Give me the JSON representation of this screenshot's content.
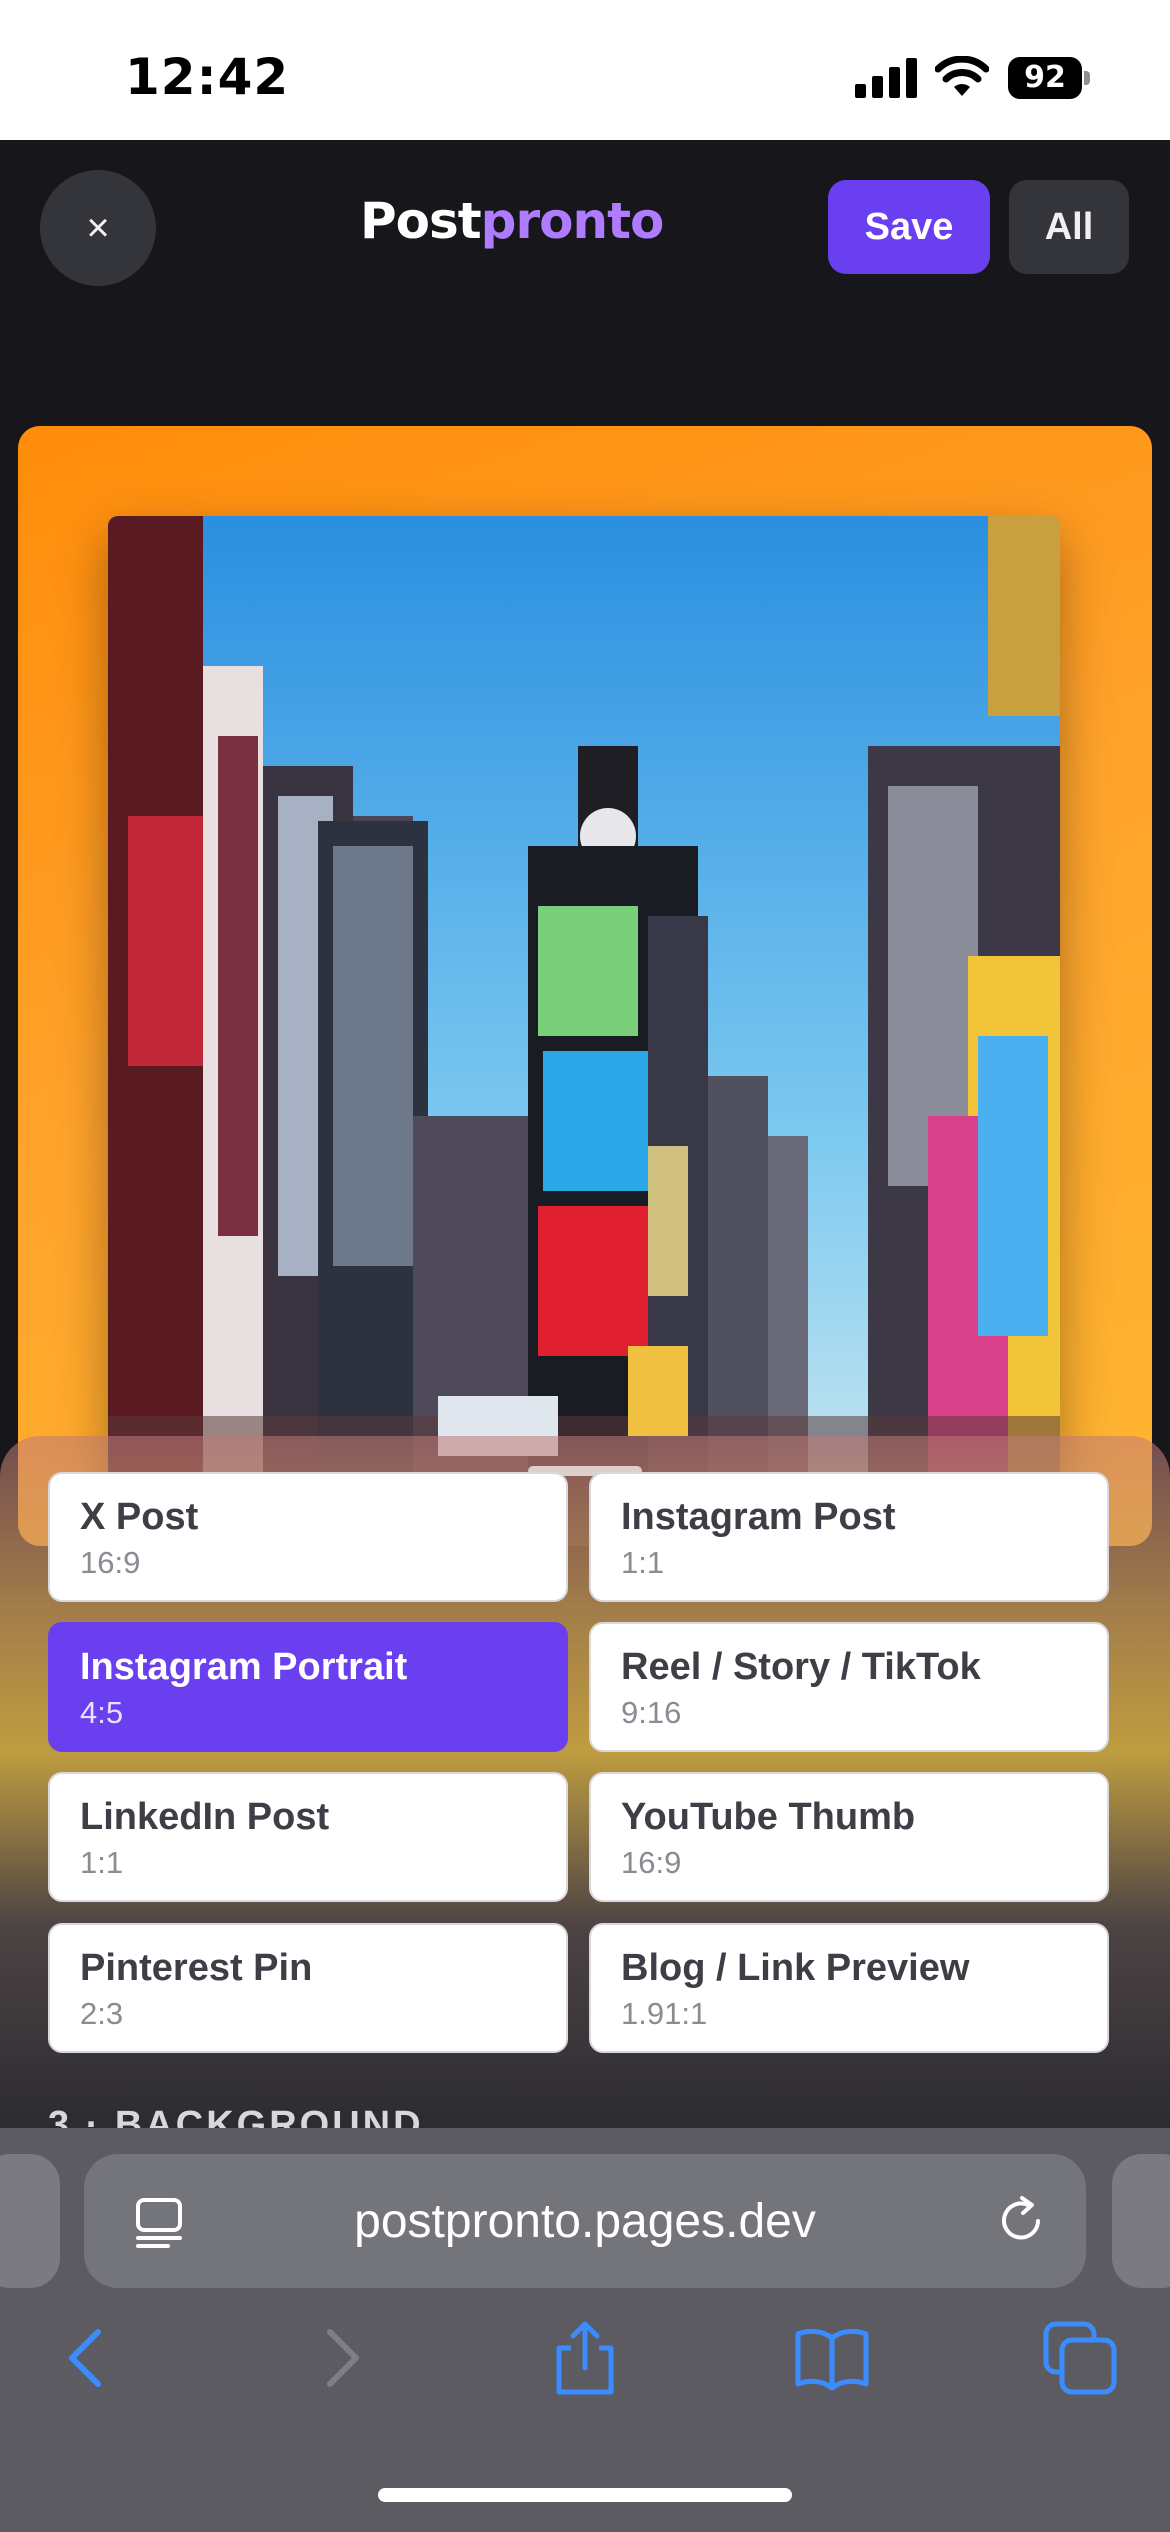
{
  "status_bar": {
    "time": "12:42",
    "battery": "92"
  },
  "header": {
    "close_symbol": "×",
    "logo_part1": "Post",
    "logo_part2": "pronto",
    "save_label": "Save",
    "all_label": "All"
  },
  "presets": [
    {
      "name": "X Post",
      "ratio": "16:9",
      "selected": false
    },
    {
      "name": "Instagram Post",
      "ratio": "1:1",
      "selected": false
    },
    {
      "name": "Instagram Portrait",
      "ratio": "4:5",
      "selected": true
    },
    {
      "name": "Reel / Story / TikTok",
      "ratio": "9:16",
      "selected": false
    },
    {
      "name": "LinkedIn Post",
      "ratio": "1:1",
      "selected": false
    },
    {
      "name": "YouTube Thumb",
      "ratio": "16:9",
      "selected": false
    },
    {
      "name": "Pinterest Pin",
      "ratio": "2:3",
      "selected": false
    },
    {
      "name": "Blog / Link Preview",
      "ratio": "1.91:1",
      "selected": false
    }
  ],
  "section_label": "3 · BACKGROUND",
  "browser": {
    "url": "postpronto.pages.dev"
  },
  "colors": {
    "accent": "#6a3ff0",
    "logo_accent": "#b07cff",
    "canvas_bg": "#ff9a1f"
  },
  "icons": {
    "status": [
      "cellular-signal-icon",
      "wifi-icon",
      "battery-icon"
    ],
    "toolbar": [
      "back-icon",
      "forward-icon",
      "share-icon",
      "bookmarks-icon",
      "tabs-icon"
    ],
    "urlbar": [
      "page-menu-icon",
      "reload-icon"
    ]
  }
}
